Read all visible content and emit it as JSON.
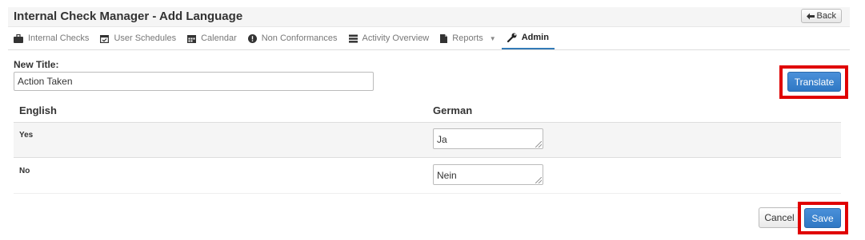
{
  "header": {
    "title": "Internal Check Manager - Add Language",
    "back_label": "Back"
  },
  "nav": {
    "items": [
      {
        "label": "Internal Checks",
        "icon": "briefcase-icon"
      },
      {
        "label": "User Schedules",
        "icon": "calendar-check-icon"
      },
      {
        "label": "Calendar",
        "icon": "calendar-icon"
      },
      {
        "label": "Non Conformances",
        "icon": "exclamation-circle-icon"
      },
      {
        "label": "Activity Overview",
        "icon": "list-icon"
      },
      {
        "label": "Reports",
        "icon": "file-icon"
      },
      {
        "label": "Admin",
        "icon": "wrench-icon"
      }
    ],
    "active": "Admin"
  },
  "form": {
    "new_title_label": "New Title:",
    "new_title_value": "Action Taken",
    "translate_label": "Translate"
  },
  "table": {
    "col_source": "English",
    "col_target": "German",
    "rows": [
      {
        "source": "Yes",
        "target": "Ja"
      },
      {
        "source": "No",
        "target": "Nein"
      }
    ]
  },
  "footer": {
    "cancel_label": "Cancel",
    "save_label": "Save"
  },
  "colors": {
    "accent": "#337ab7",
    "highlight": "#e00000"
  }
}
